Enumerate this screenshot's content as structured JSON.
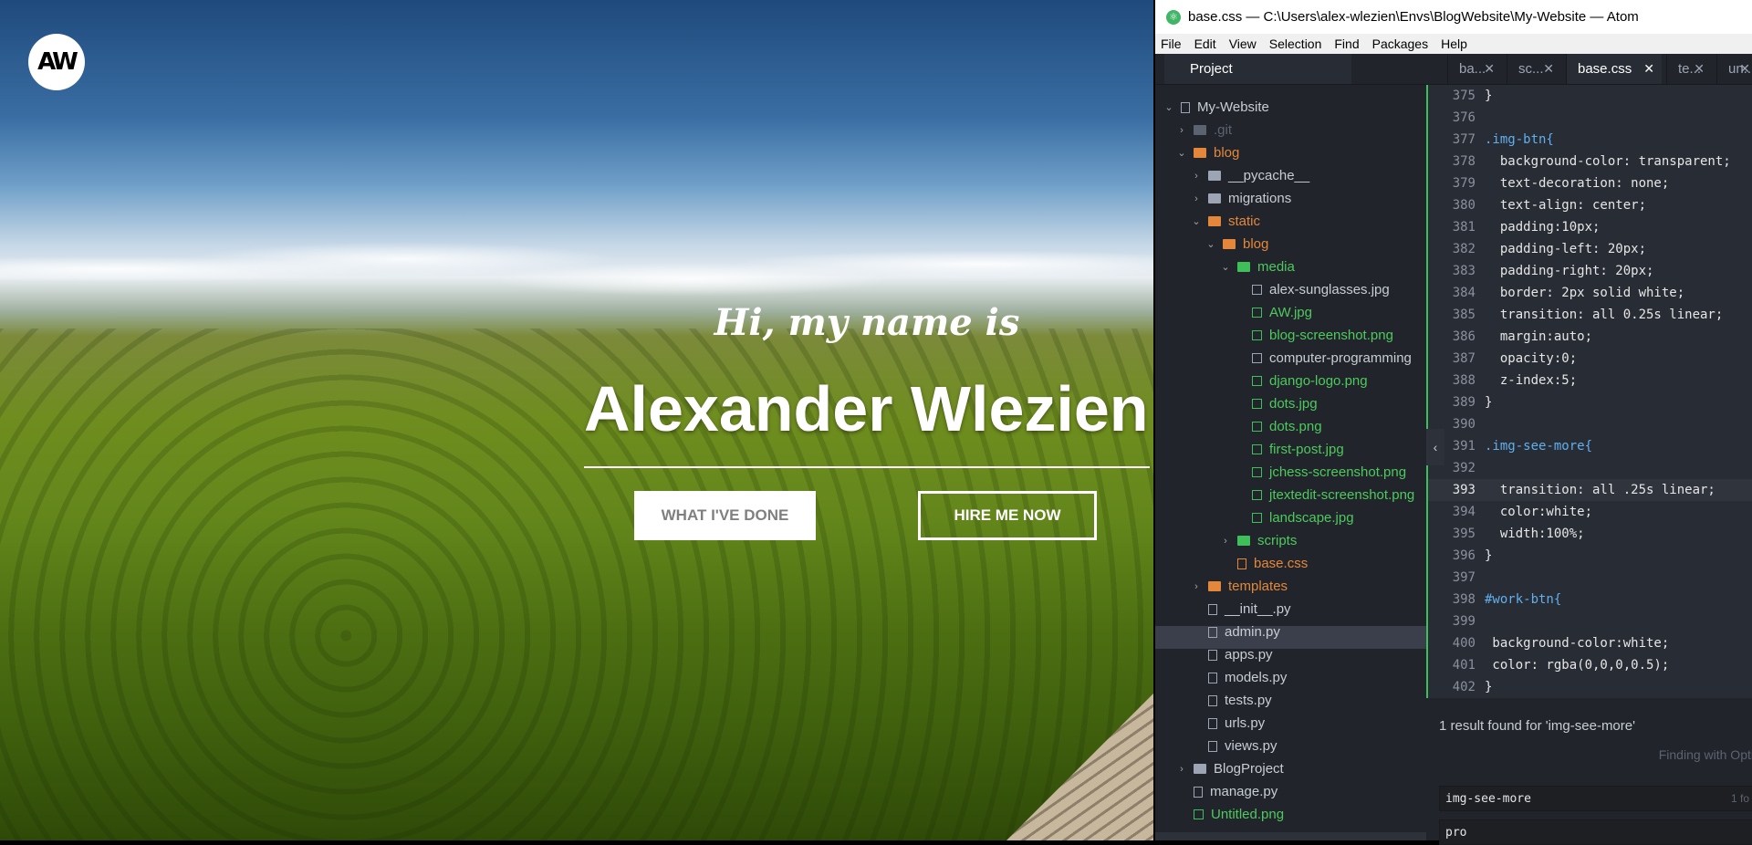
{
  "site": {
    "logo_text": "AW",
    "greeting": "Hi, my name is",
    "name": "Alexander Wlezien",
    "work_button": "WHAT I'VE DONE",
    "hire_button": "HIRE ME NOW"
  },
  "atom": {
    "title": "base.css — C:\\Users\\alex-wlezien\\Envs\\BlogWebsite\\My-Website — Atom",
    "menu": [
      "File",
      "Edit",
      "View",
      "Selection",
      "Find",
      "Packages",
      "Help"
    ],
    "project_tab": "Project",
    "tabs": [
      {
        "label": "ba...",
        "active": false
      },
      {
        "label": "sc...",
        "active": false
      },
      {
        "label": "base.css",
        "active": true
      },
      {
        "label": "te...",
        "active": false
      },
      {
        "label": "un...",
        "active": false
      }
    ],
    "tree": [
      {
        "label": "My-Website",
        "chev": "v",
        "icon": "repo",
        "color": "white"
      },
      {
        "label": ".git",
        "chev": ">",
        "icon": "folder-dim",
        "color": "dim"
      },
      {
        "label": "blog",
        "chev": "v",
        "icon": "folder-orange",
        "color": "orange"
      },
      {
        "label": "__pycache__",
        "chev": ">",
        "icon": "folder",
        "color": "white"
      },
      {
        "label": "migrations",
        "chev": ">",
        "icon": "folder",
        "color": "white"
      },
      {
        "label": "static",
        "chev": "v",
        "icon": "folder-orange",
        "color": "orange"
      },
      {
        "label": "blog",
        "chev": "v",
        "icon": "folder-orange",
        "color": "orange"
      },
      {
        "label": "media",
        "chev": "v",
        "icon": "folder-green",
        "color": "green"
      },
      {
        "label": "alex-sunglasses.jpg",
        "chev": "",
        "icon": "img",
        "color": "white"
      },
      {
        "label": "AW.jpg",
        "chev": "",
        "icon": "img-green",
        "color": "green"
      },
      {
        "label": "blog-screenshot.png",
        "chev": "",
        "icon": "img-green",
        "color": "green"
      },
      {
        "label": "computer-programming",
        "chev": "",
        "icon": "img",
        "color": "white"
      },
      {
        "label": "django-logo.png",
        "chev": "",
        "icon": "img-green",
        "color": "green"
      },
      {
        "label": "dots.jpg",
        "chev": "",
        "icon": "img-green",
        "color": "green"
      },
      {
        "label": "dots.png",
        "chev": "",
        "icon": "img-green",
        "color": "green"
      },
      {
        "label": "first-post.jpg",
        "chev": "",
        "icon": "img-green",
        "color": "green"
      },
      {
        "label": "jchess-screenshot.png",
        "chev": "",
        "icon": "img-green",
        "color": "green"
      },
      {
        "label": "jtextedit-screenshot.png",
        "chev": "",
        "icon": "img-green",
        "color": "green"
      },
      {
        "label": "landscape.jpg",
        "chev": "",
        "icon": "img-green",
        "color": "green"
      },
      {
        "label": "scripts",
        "chev": ">",
        "icon": "folder-green",
        "color": "green"
      },
      {
        "label": "base.css",
        "chev": "",
        "icon": "file-orange",
        "color": "orange"
      },
      {
        "label": "templates",
        "chev": ">",
        "icon": "folder-orange",
        "color": "orange"
      },
      {
        "label": "__init__.py",
        "chev": "",
        "icon": "file",
        "color": "white"
      },
      {
        "label": "admin.py",
        "chev": "",
        "icon": "file",
        "color": "white"
      },
      {
        "label": "apps.py",
        "chev": "",
        "icon": "file",
        "color": "white"
      },
      {
        "label": "models.py",
        "chev": "",
        "icon": "file",
        "color": "white"
      },
      {
        "label": "tests.py",
        "chev": "",
        "icon": "file",
        "color": "white"
      },
      {
        "label": "urls.py",
        "chev": "",
        "icon": "file",
        "color": "white"
      },
      {
        "label": "views.py",
        "chev": "",
        "icon": "file",
        "color": "white"
      },
      {
        "label": "BlogProject",
        "chev": ">",
        "icon": "folder",
        "color": "white"
      },
      {
        "label": "manage.py",
        "chev": "",
        "icon": "file",
        "color": "white"
      },
      {
        "label": "Untitled.png",
        "chev": "",
        "icon": "img-green",
        "color": "green"
      }
    ],
    "code_lines": [
      {
        "n": "375",
        "text": "}"
      },
      {
        "n": "376",
        "text": ""
      },
      {
        "n": "377",
        "text": ".img-btn{"
      },
      {
        "n": "378",
        "text": "  background-color: transparent;"
      },
      {
        "n": "379",
        "text": "  text-decoration: none;"
      },
      {
        "n": "380",
        "text": "  text-align: center;"
      },
      {
        "n": "381",
        "text": "  padding:10px;"
      },
      {
        "n": "382",
        "text": "  padding-left: 20px;"
      },
      {
        "n": "383",
        "text": "  padding-right: 20px;"
      },
      {
        "n": "384",
        "text": "  border: 2px solid white;"
      },
      {
        "n": "385",
        "text": "  transition: all 0.25s linear;"
      },
      {
        "n": "386",
        "text": "  margin:auto;"
      },
      {
        "n": "387",
        "text": "  opacity:0;"
      },
      {
        "n": "388",
        "text": "  z-index:5;"
      },
      {
        "n": "389",
        "text": "}"
      },
      {
        "n": "390",
        "text": ""
      },
      {
        "n": "391",
        "text": ".img-see-more{"
      },
      {
        "n": "392",
        "text": ""
      },
      {
        "n": "393",
        "text": "  transition: all .25s linear;"
      },
      {
        "n": "394",
        "text": "  color:white;"
      },
      {
        "n": "395",
        "text": "  width:100%;"
      },
      {
        "n": "396",
        "text": "}"
      },
      {
        "n": "397",
        "text": ""
      },
      {
        "n": "398",
        "text": "#work-btn{"
      },
      {
        "n": "399",
        "text": ""
      },
      {
        "n": "400",
        "text": " background-color:white;"
      },
      {
        "n": "401",
        "text": " color: rgba(0,0,0,0.5);"
      },
      {
        "n": "402",
        "text": "}"
      }
    ],
    "find": {
      "summary": "1 result found for 'img-see-more'",
      "hint": "Finding with Opti",
      "query": "img-see-more",
      "count": "1 fo",
      "replace": "pro"
    }
  }
}
